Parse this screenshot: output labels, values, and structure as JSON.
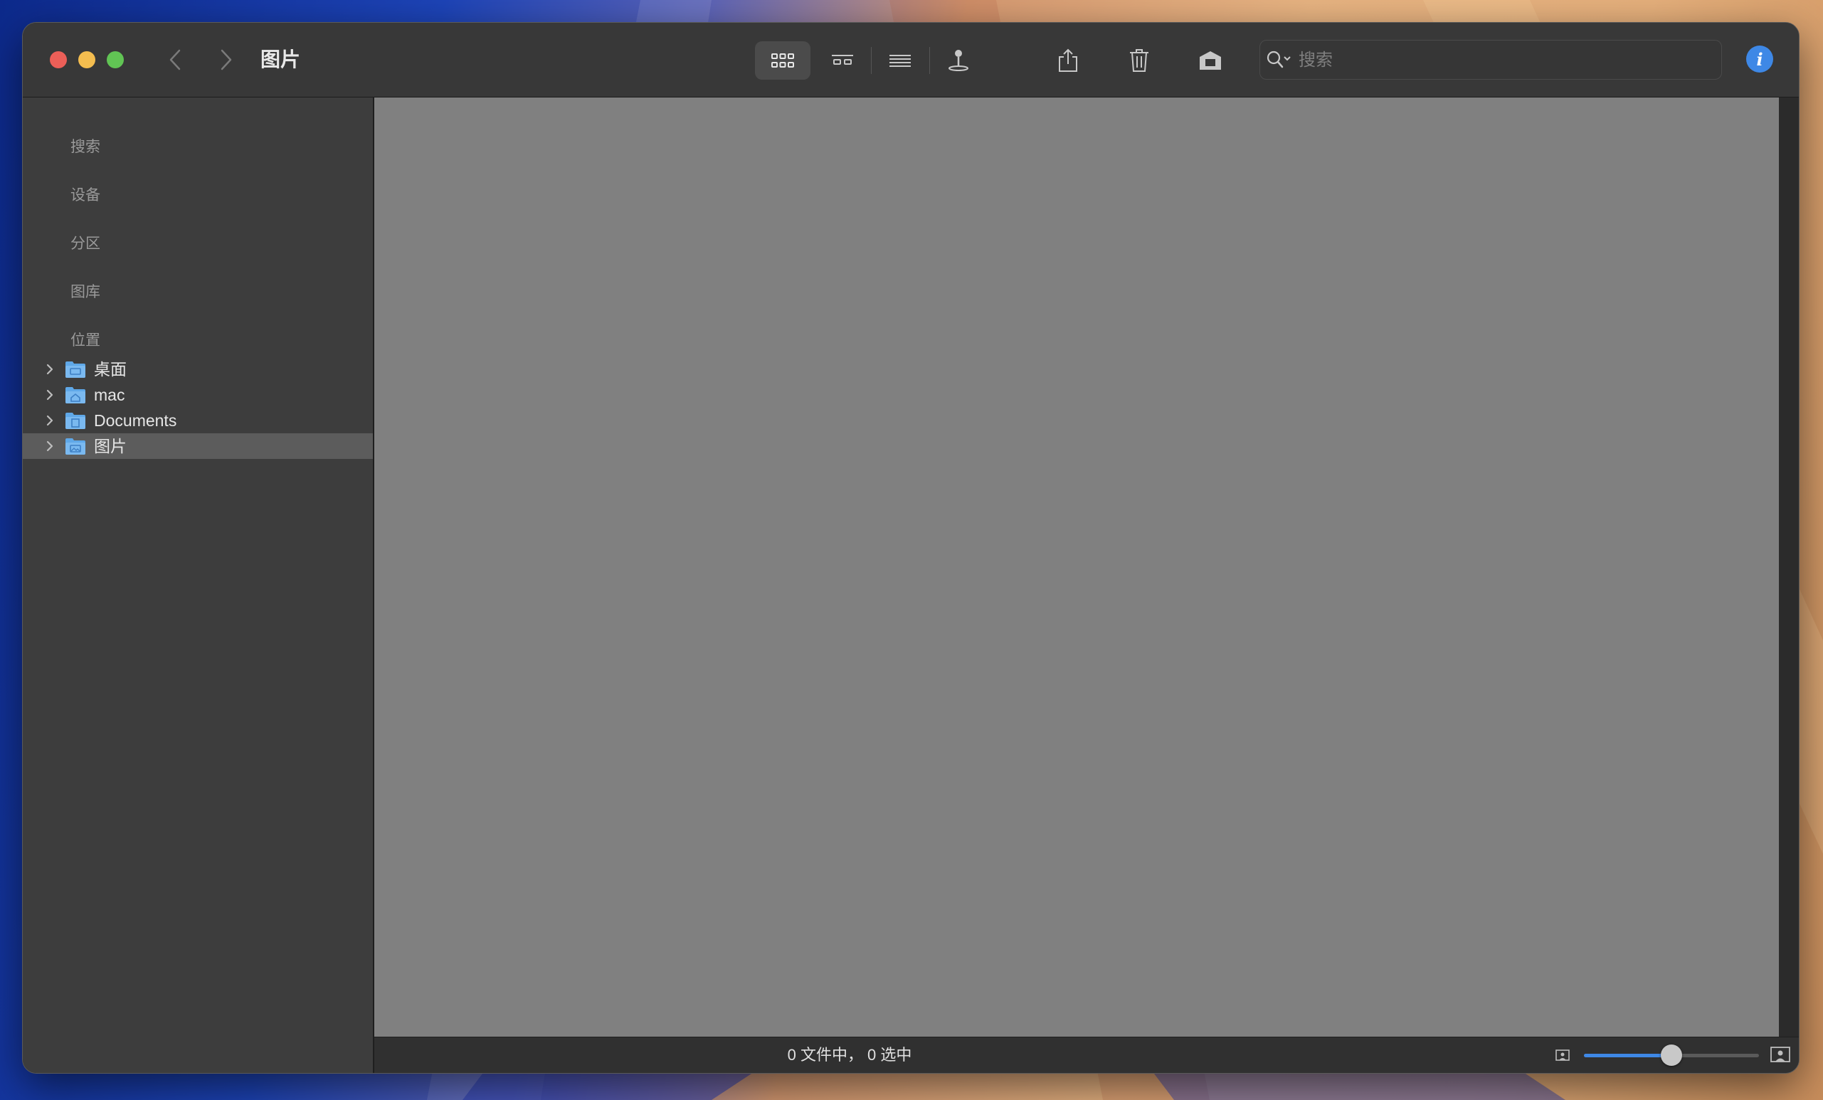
{
  "window": {
    "title": "图片"
  },
  "toolbar": {
    "view_buttons": [
      "grid-view-icon",
      "gallery-view-icon",
      "list-view-icon",
      "pin-icon"
    ],
    "actions": [
      "share-icon",
      "trash-icon",
      "clear-icon"
    ]
  },
  "search": {
    "placeholder": "搜索",
    "value": ""
  },
  "info": {
    "label": "i"
  },
  "sidebar": {
    "sections": [
      {
        "label": "搜索"
      },
      {
        "label": "设备"
      },
      {
        "label": "分区"
      },
      {
        "label": "图库"
      },
      {
        "label": "位置"
      }
    ],
    "locations": [
      {
        "label": "桌面",
        "icon": "desktop-folder-icon",
        "selected": false
      },
      {
        "label": "mac",
        "icon": "home-folder-icon",
        "selected": false
      },
      {
        "label": "Documents",
        "icon": "documents-folder-icon",
        "selected": false
      },
      {
        "label": "图片",
        "icon": "pictures-folder-icon",
        "selected": true
      }
    ]
  },
  "status": {
    "text": "0 文件中， 0 选中",
    "zoom_level": 0.5
  },
  "colors": {
    "accent": "#3e88e6",
    "close": "#ec5f58",
    "minimize": "#f4bd4f",
    "maximize": "#61c454",
    "content_bg": "#808080",
    "sidebar_bg": "#3d3d3d",
    "folder": "#5fa8e8"
  }
}
